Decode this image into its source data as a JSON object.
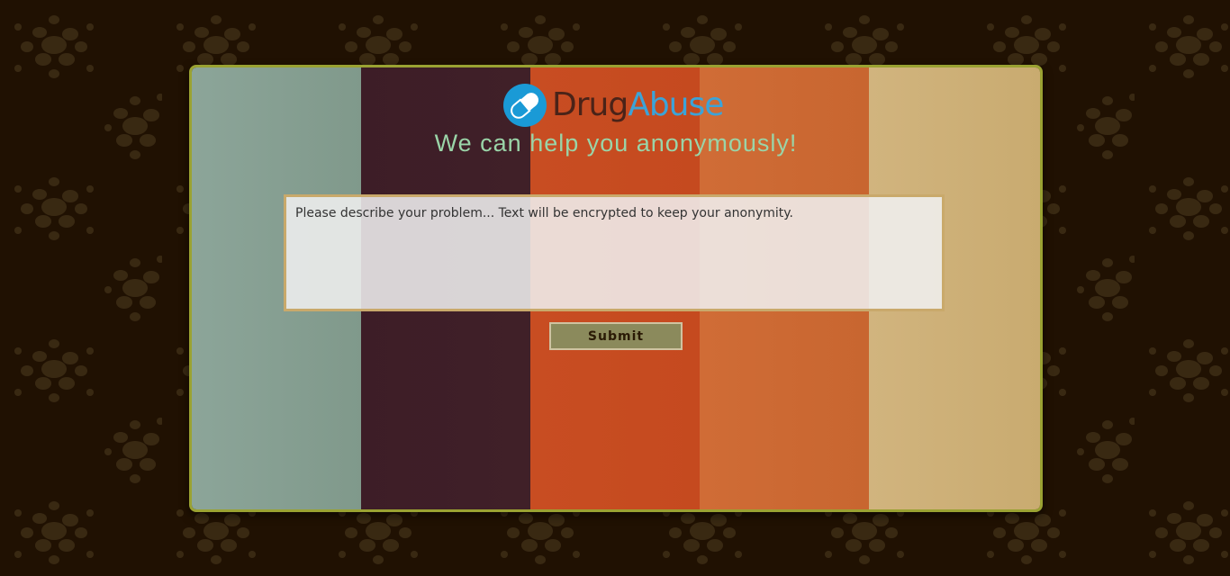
{
  "logo": {
    "word1": "Drug",
    "word2": "Abuse",
    "word1_color": "#4a2318",
    "word2_color": "#3ca3d8",
    "icon": "pill-capsule-icon"
  },
  "tagline": "We can help you anonymously!",
  "form": {
    "problem_placeholder": "Please describe your problem... Text will be encrypted to keep your anonymity.",
    "problem_value": "",
    "submit_label": "Submit"
  },
  "colors": {
    "page_background": "#201102",
    "card_border": "#9aa232",
    "stripes": [
      "#8ca599",
      "#3d1d27",
      "#c84d22",
      "#d06c36",
      "#d1b47e"
    ],
    "tagline": "#9ad4a8",
    "submit_background": "#8b8a5c"
  }
}
